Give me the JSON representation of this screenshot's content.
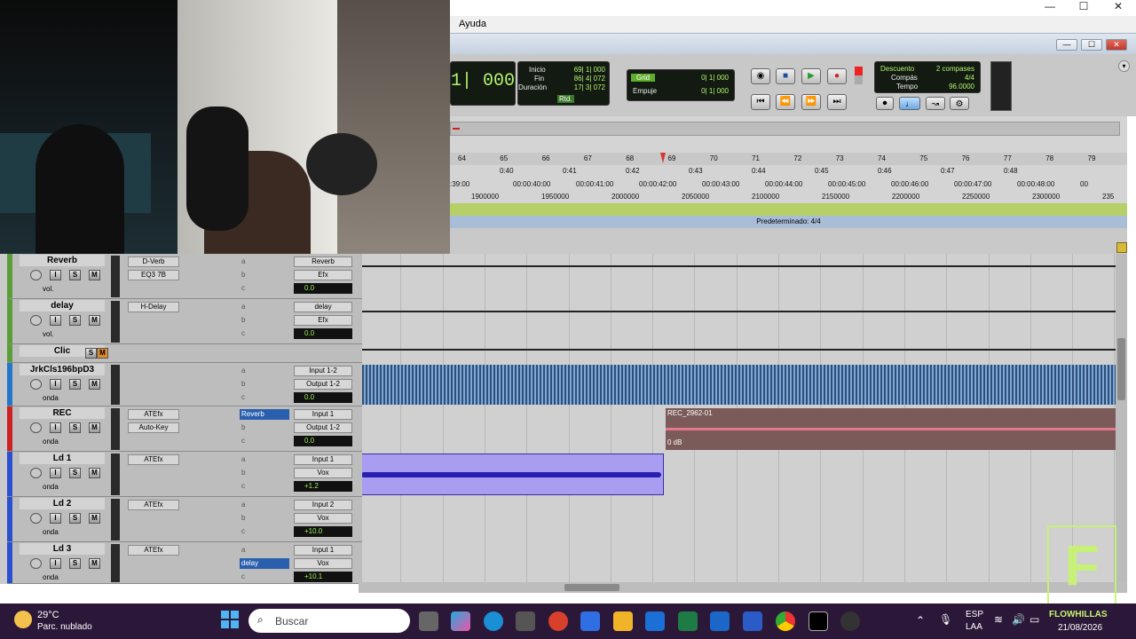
{
  "window": {
    "menu": "Ayuda",
    "controls": [
      "—",
      "☐",
      "✕"
    ],
    "inner_controls": [
      "—",
      "☐",
      "✕"
    ]
  },
  "transport": {
    "main_counter": "1| 000",
    "inicio_label": "Inicio",
    "inicio": "69| 1| 000",
    "fin_label": "Fin",
    "fin": "86| 4| 072",
    "duracion_label": "Duración",
    "duracion": "17| 3| 072",
    "rtd": "Rtd.",
    "grid_label": "Grid",
    "grid": "0| 1| 000",
    "empuje_label": "Empuje",
    "empuje": "0| 1| 000",
    "descuento_label": "Descuento",
    "descuento": "2 compases",
    "compas_label": "Compás",
    "compas": "4/4",
    "tempo_label": "Tempo",
    "tempo": "96.0000"
  },
  "ruler": {
    "bars": [
      "64",
      "65",
      "66",
      "67",
      "68",
      "69",
      "70",
      "71",
      "72",
      "73",
      "74",
      "75",
      "76",
      "77",
      "78",
      "79"
    ],
    "minsec": [
      "0:40",
      "0:41",
      "0:42",
      "0:43",
      "0:44",
      "0:45",
      "0:46",
      "0:47",
      "0:48"
    ],
    "timecode": [
      ":39:00",
      "00:00:40:00",
      "00:00:41:00",
      "00:00:42:00",
      "00:00:43:00",
      "00:00:44:00",
      "00:00:45:00",
      "00:00:46:00",
      "00:00:47:00",
      "00:00:48:00",
      "00"
    ],
    "samples": [
      "1900000",
      "1950000",
      "2000000",
      "2050000",
      "2100000",
      "2150000",
      "2200000",
      "2250000",
      "2300000",
      "235"
    ],
    "meter_label": "Predeterminado: 4/4"
  },
  "tracks": [
    {
      "name": "Reverb",
      "color": "#5a9e3a",
      "inserts": [
        "D-Verb",
        "EQ3 7B"
      ],
      "sends": [
        "a",
        "b",
        "c"
      ],
      "io": [
        "Reverb",
        "Efx"
      ],
      "vol": "0.0",
      "mode": "vol."
    },
    {
      "name": "delay",
      "color": "#5a9e3a",
      "inserts": [
        "H-Delay"
      ],
      "sends": [
        "a",
        "b",
        "c"
      ],
      "io": [
        "delay",
        "Efx"
      ],
      "vol": "0.0",
      "mode": "vol."
    },
    {
      "name": "Clic",
      "color": "#5a9e3a"
    },
    {
      "name": "JrkCls196bpD3",
      "color": "#2277cc",
      "sends": [
        "a",
        "b",
        "c"
      ],
      "io": [
        "Input 1-2",
        "Output 1-2"
      ],
      "vol": "0.0",
      "mode": "onda"
    },
    {
      "name": "REC",
      "color": "#cc2222",
      "inserts": [
        "ATEfx",
        "Auto-Key"
      ],
      "sends": [
        "Reverb",
        "b",
        "c"
      ],
      "io": [
        "Input 1",
        "Output 1-2"
      ],
      "vol": "0.0",
      "mode": "onda",
      "clip": "REC_2962-01",
      "clip_gain": "0 dB"
    },
    {
      "name": "Ld 1",
      "color": "#2a4fd0",
      "inserts": [
        "ATEfx"
      ],
      "sends": [
        "a",
        "b",
        "c"
      ],
      "io": [
        "Input 1",
        "Vox"
      ],
      "vol": "+1.2",
      "mode": "onda"
    },
    {
      "name": "Ld 2",
      "color": "#2a4fd0",
      "inserts": [
        "ATEfx"
      ],
      "sends": [
        "a",
        "b",
        "c"
      ],
      "io": [
        "Input 2",
        "Vox"
      ],
      "vol": "+10.0",
      "mode": "onda"
    },
    {
      "name": "Ld 3",
      "color": "#2a4fd0",
      "inserts": [
        "ATEfx"
      ],
      "sends": [
        "a",
        "delay",
        "c"
      ],
      "io": [
        "Input 1",
        "Vox"
      ],
      "vol": "+10.1",
      "mode": "onda"
    }
  ],
  "taskbar": {
    "weather_temp": "29°C",
    "weather_desc": "Parc. nublado",
    "search": "Buscar",
    "lang1": "ESP",
    "lang2": "LAA",
    "date": "21/08/2026",
    "brand": "FLOWHILLAS"
  }
}
